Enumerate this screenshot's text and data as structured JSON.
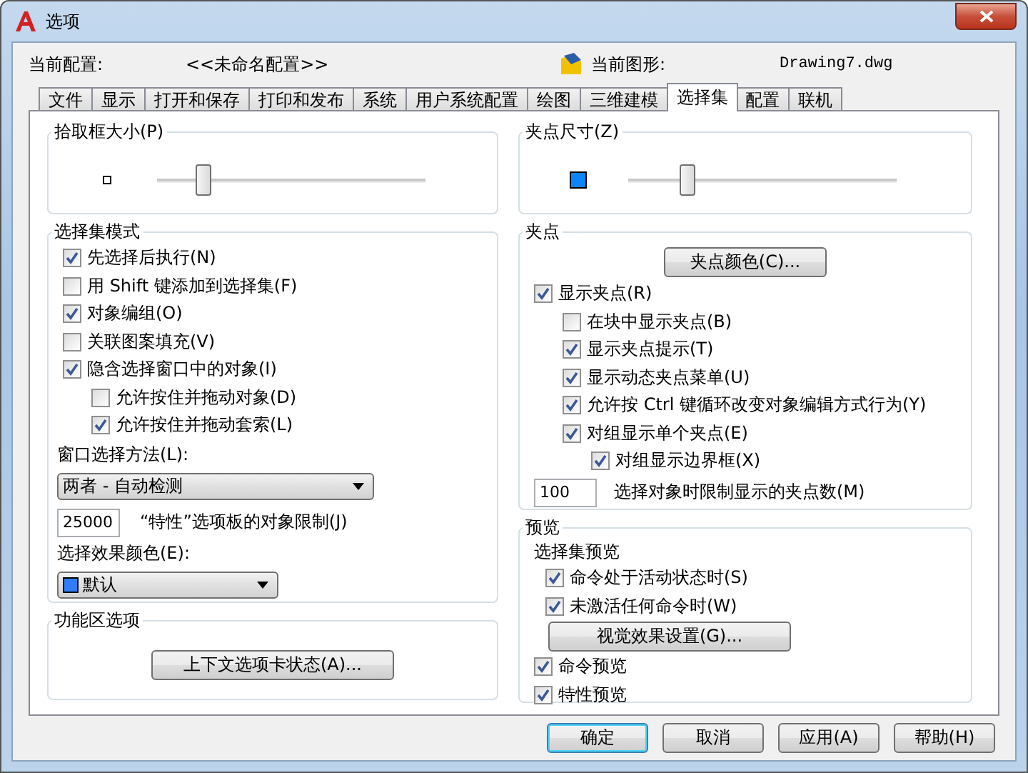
{
  "window": {
    "title": "选项"
  },
  "profile": {
    "label": "当前配置:",
    "value": "<<未命名配置>>"
  },
  "drawing": {
    "label": "当前图形:",
    "value": "Drawing7.dwg"
  },
  "tabs": [
    {
      "label": "文件",
      "selected": false
    },
    {
      "label": "显示",
      "selected": false
    },
    {
      "label": "打开和保存",
      "selected": false
    },
    {
      "label": "打印和发布",
      "selected": false
    },
    {
      "label": "系统",
      "selected": false
    },
    {
      "label": "用户系统配置",
      "selected": false
    },
    {
      "label": "绘图",
      "selected": false
    },
    {
      "label": "三维建模",
      "selected": false
    },
    {
      "label": "选择集",
      "selected": true
    },
    {
      "label": "配置",
      "selected": false
    },
    {
      "label": "联机",
      "selected": false
    }
  ],
  "pickbox": {
    "title": "拾取框大小(P)",
    "level": 0.17
  },
  "selection_modes": {
    "title": "选择集模式",
    "items": [
      {
        "label": "先选择后执行(N)",
        "checked": true
      },
      {
        "label": "用 Shift 键添加到选择集(F)",
        "checked": false
      },
      {
        "label": "对象编组(O)",
        "checked": true
      },
      {
        "label": "关联图案填充(V)",
        "checked": false
      },
      {
        "label": "隐含选择窗口中的对象(I)",
        "checked": true,
        "children": [
          {
            "label": "允许按住并拖动对象(D)",
            "checked": false
          },
          {
            "label": "允许按住并拖动套索(L)",
            "checked": true
          }
        ]
      }
    ],
    "window_method": {
      "label": "窗口选择方法(L):",
      "value": "两者 - 自动检测"
    },
    "object_limit": {
      "value": "25000",
      "label": "“特性”选项板的对象限制(J)"
    },
    "effect_color": {
      "label": "选择效果颜色(E):",
      "value": "默认"
    }
  },
  "ribbon": {
    "title": "功能区选项",
    "button": "上下文选项卡状态(A)..."
  },
  "grip_size": {
    "title": "夹点尺寸(Z)",
    "level": 0.22
  },
  "grips": {
    "title": "夹点",
    "button": "夹点颜色(C)...",
    "items": [
      {
        "label": "显示夹点(R)",
        "checked": true,
        "children": [
          {
            "label": "在块中显示夹点(B)",
            "checked": false
          },
          {
            "label": "显示夹点提示(T)",
            "checked": true
          },
          {
            "label": "显示动态夹点菜单(U)",
            "checked": true
          },
          {
            "label": "允许按 Ctrl 键循环改变对象编辑方式行为(Y)",
            "checked": true
          },
          {
            "label": "对组显示单个夹点(E)",
            "checked": true,
            "children": [
              {
                "label": "对组显示边界框(X)",
                "checked": true
              }
            ]
          }
        ]
      }
    ],
    "limit": {
      "value": "100",
      "label": "选择对象时限制显示的夹点数(M)"
    }
  },
  "preview": {
    "title": "预览",
    "subtitle": "选择集预览",
    "sub_items": [
      {
        "label": "命令处于活动状态时(S)",
        "checked": true
      },
      {
        "label": "未激活任何命令时(W)",
        "checked": true
      }
    ],
    "button": "视觉效果设置(G)...",
    "items": [
      {
        "label": "命令预览",
        "checked": true
      },
      {
        "label": "特性预览",
        "checked": true
      }
    ]
  },
  "buttons": [
    {
      "label": "确定",
      "default": true
    },
    {
      "label": "取消",
      "default": false
    },
    {
      "label": "应用(A)",
      "default": false
    },
    {
      "label": "帮助(H)",
      "default": false
    }
  ]
}
